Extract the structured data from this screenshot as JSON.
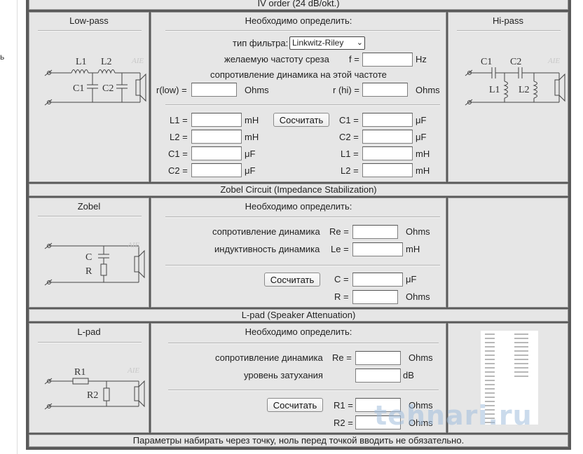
{
  "top_header": "IV order (24 dB/okt.)",
  "sidebar_letter": "ь",
  "lowpass": {
    "title": "Low-pass",
    "brand": "AIE",
    "l1": "L1",
    "l2": "L2",
    "c1": "C1",
    "c2": "C2"
  },
  "hipass": {
    "title": "Hi-pass",
    "brand": "AIE",
    "c1": "C1",
    "c2": "C2",
    "l1": "L1",
    "l2": "L2"
  },
  "calc4": {
    "title": "Необходимо определить:",
    "filter_type_label": "тип фильтра:",
    "filter_type_value": "Linkwitz-Riley",
    "freq_label": "желаемую частоту среза",
    "freq_prefix": "f =",
    "freq_unit": "Hz",
    "res_label": "сопротивление динамика на этой частоте",
    "rlow_label": "r(low) =",
    "rlow_unit": "Ohms",
    "rhi_label": "r (hi) =",
    "rhi_unit": "Ohms",
    "button": "Сосчитать",
    "left_results": [
      {
        "label": "L1 =",
        "unit": "mH"
      },
      {
        "label": "L2 =",
        "unit": "mH"
      },
      {
        "label": "C1 =",
        "unit": "μF"
      },
      {
        "label": "C2 =",
        "unit": "μF"
      }
    ],
    "right_results": [
      {
        "label": "C1 =",
        "unit": "μF"
      },
      {
        "label": "C2 =",
        "unit": "μF"
      },
      {
        "label": "L1 =",
        "unit": "mH"
      },
      {
        "label": "L2 =",
        "unit": "mH"
      }
    ]
  },
  "zobel_header": "Zobel Circuit (Impedance Stabilization)",
  "zobel": {
    "title": "Zobel",
    "brand": "AIE",
    "c": "C",
    "r": "R",
    "calc_title": "Необходимо определить:",
    "re_label": "сопротивление динамика",
    "re_prefix": "Re =",
    "re_unit": "Ohms",
    "le_label": "индуктивность динамика",
    "le_prefix": "Le =",
    "le_unit": "mH",
    "button": "Сосчитать",
    "c_prefix": "C =",
    "c_unit": "μF",
    "r_prefix": "R =",
    "r_unit": "Ohms"
  },
  "lpad_header": "L-pad (Speaker Attenuation)",
  "lpad": {
    "title": "L-pad",
    "brand": "AIE",
    "r1": "R1",
    "r2": "R2",
    "calc_title": "Необходимо определить:",
    "re_label": "сопротивление динамика",
    "re_prefix": "Re =",
    "re_unit": "Ohms",
    "att_label": "уровень затухания",
    "att_unit": "dB",
    "button": "Сосчитать",
    "r1_prefix": "R1 =",
    "r1_unit": "Ohms",
    "r2_prefix": "R2 =",
    "r2_unit": "Ohms"
  },
  "footer_note": "Параметры набирать через точку, ноль перед точкой вводить не обязательно.",
  "watermark": "tehnari.ru"
}
